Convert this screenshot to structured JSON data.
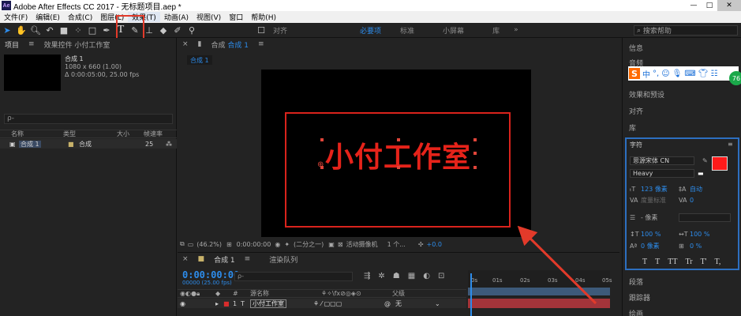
{
  "titlebar": {
    "app_icon": "Ae",
    "title": "Adobe After Effects CC 2017 - 无标题项目.aep *",
    "minimize": "—",
    "maximize": "□",
    "close": "✕"
  },
  "menu": [
    "文件(F)",
    "编辑(E)",
    "合成(C)",
    "图层(L)",
    "效果(T)",
    "动画(A)",
    "视图(V)",
    "窗口",
    "帮助(H)"
  ],
  "toolbar": {
    "tools": [
      "selection-arrow",
      "hand",
      "zoom",
      "rotate",
      "camera",
      "pan-behind",
      "rectangle",
      "pen"
    ],
    "text_tool": "T",
    "snap_label": "对齐",
    "workspaces": [
      "必要项",
      "标准",
      "小屏幕",
      "库"
    ],
    "more": "»",
    "search_placeholder": "搜索帮助"
  },
  "project_panel": {
    "tab_project": "项目",
    "tab_effects": "效果控件 小付工作室",
    "comp_name": "合成 1",
    "comp_size": "1080 x 660 (1.00)",
    "comp_duration": "Δ 0:00:05:00, 25.00 fps",
    "search_icon": "ρ-",
    "columns": [
      "名称",
      "类型",
      "大小",
      "帧速率"
    ],
    "rows": [
      {
        "name": "合成 1",
        "type": "合成",
        "size": "",
        "fps": "25"
      }
    ]
  },
  "viewer": {
    "tab_label": "合成",
    "tab_name": "合成 1",
    "subtab": "合成 1",
    "canvas_text": "小付工作室",
    "zoom": "(46.2%)",
    "timecode": "0:00:00:00",
    "resolution": "(二分之一)",
    "camera": "活动摄像机",
    "views": "1 个...",
    "exposure": "+0.0"
  },
  "timeline": {
    "tab_comp": "合成 1",
    "tab_render": "渲染队列",
    "timecode": "0:00:00:00",
    "timecode_sub": "00000 (25.00 fps)",
    "search_icon": "ρ-",
    "header_source": "源名称",
    "header_parent": "父级",
    "layer_number": "1",
    "layer_type": "T",
    "layer_name": "小付工作室",
    "layer_parent": "无",
    "ruler_ticks": [
      "0s",
      "01s",
      "02s",
      "03s",
      "04s",
      "05s"
    ]
  },
  "right_panel": {
    "items": [
      "信息",
      "音频",
      "效果和预设",
      "对齐",
      "库"
    ],
    "character": {
      "title": "字符",
      "font": "思源宋体 CN",
      "style": "Heavy",
      "size": "123 像素",
      "leading": "自动",
      "kerning": "度量标准",
      "tracking": "0",
      "stroke": "- 像素",
      "vscale": "100 %",
      "hscale": "100 %",
      "baseline": "0 像素",
      "tsume": "0 %",
      "styles": [
        "T",
        "T",
        "TT",
        "Tr",
        "T'",
        "T,"
      ]
    },
    "bottom_items": [
      "段落",
      "跟踪器",
      "绘画"
    ],
    "ime": {
      "logo": "S",
      "lang": "中",
      "badge": "76"
    }
  },
  "colors": {
    "accent": "#2d8ceb",
    "text_red": "#e6231a",
    "frame_red": "#d9231c",
    "highlight_box": "#e23a2a"
  }
}
